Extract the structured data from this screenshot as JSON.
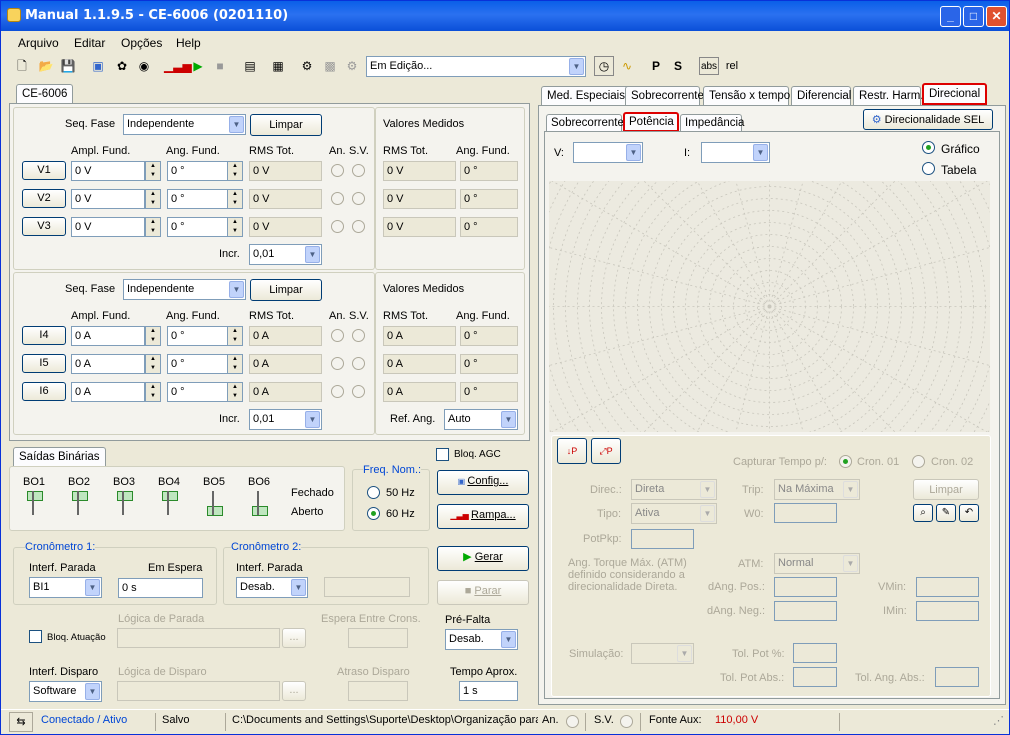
{
  "window": {
    "title": "Manual 1.1.9.5 - CE-6006 (0201110)"
  },
  "menu": [
    "Arquivo",
    "Editar",
    "Opções",
    "Help"
  ],
  "toolbar": {
    "mode": "Em Edição...",
    "abs": "abs",
    "rel": "rel"
  },
  "device_tab": "CE-6006",
  "voltage": {
    "seq_label": "Seq. Fase",
    "seq_value": "Independente",
    "clear": "Limpar",
    "measured_title": "Valores Medidos",
    "headers": {
      "ampl": "Ampl. Fund.",
      "ang": "Ang. Fund.",
      "rms": "RMS Tot.",
      "an": "An.",
      "sv": "S.V.",
      "m_rms": "RMS Tot.",
      "m_ang": "Ang. Fund."
    },
    "rows": [
      {
        "name": "V1",
        "ampl": "0 V",
        "ang": "0 °",
        "rms": "0 V",
        "m_rms": "0 V",
        "m_ang": "0 °"
      },
      {
        "name": "V2",
        "ampl": "0 V",
        "ang": "0 °",
        "rms": "0 V",
        "m_rms": "0 V",
        "m_ang": "0 °"
      },
      {
        "name": "V3",
        "ampl": "0 V",
        "ang": "0 °",
        "rms": "0 V",
        "m_rms": "0 V",
        "m_ang": "0 °"
      }
    ],
    "incr_label": "Incr.",
    "incr": "0,01"
  },
  "current": {
    "seq_label": "Seq. Fase",
    "seq_value": "Independente",
    "clear": "Limpar",
    "measured_title": "Valores Medidos",
    "headers": {
      "ampl": "Ampl. Fund.",
      "ang": "Ang. Fund.",
      "rms": "RMS Tot.",
      "an": "An.",
      "sv": "S.V.",
      "m_rms": "RMS Tot.",
      "m_ang": "Ang. Fund."
    },
    "rows": [
      {
        "name": "I4",
        "ampl": "0 A",
        "ang": "0 °",
        "rms": "0 A",
        "m_rms": "0 A",
        "m_ang": "0 °"
      },
      {
        "name": "I5",
        "ampl": "0 A",
        "ang": "0 °",
        "rms": "0 A",
        "m_rms": "0 A",
        "m_ang": "0 °"
      },
      {
        "name": "I6",
        "ampl": "0 A",
        "ang": "0 °",
        "rms": "0 A",
        "m_rms": "0 A",
        "m_ang": "0 °"
      }
    ],
    "incr_label": "Incr.",
    "incr": "0,01",
    "ref_label": "Ref. Ang.",
    "ref": "Auto"
  },
  "binary": {
    "tab": "Saídas Binárias",
    "outputs": [
      "BO1",
      "BO2",
      "BO3",
      "BO4",
      "BO5",
      "BO6"
    ],
    "closed": "Fechado",
    "open": "Aberto"
  },
  "bloq_agc": "Bloq. AGC",
  "freq": {
    "title": "Freq. Nom.:",
    "opt1": "50 Hz",
    "opt2": "60 Hz"
  },
  "config_btn": "Config...",
  "rampa_btn": "Rampa...",
  "gerar_btn": "Gerar",
  "parar_btn": "Parar",
  "chrono1": {
    "title": "Cronômetro 1:",
    "interf": "Interf. Parada",
    "interf_val": "BI1",
    "wait": "Em Espera",
    "wait_val": "0 s",
    "logic": "Lógica de Parada",
    "bloq": "Bloq. Atuação"
  },
  "chrono2": {
    "title": "Cronômetro 2:",
    "interf": "Interf. Parada",
    "interf_val": "Desab.",
    "between": "Espera Entre Crons."
  },
  "prefalta": {
    "label": "Pré-Falta",
    "value": "Desab."
  },
  "disparo": {
    "interf": "Interf. Disparo",
    "interf_val": "Software",
    "logic": "Lógica de Disparo",
    "delay": "Atraso Disparo"
  },
  "tempo": {
    "label": "Tempo Aprox.",
    "value": "1 s"
  },
  "right_tabs": [
    "Med. Especiais",
    "Sobrecorrente",
    "Tensão x tempo",
    "Diferencial",
    "Restr. Harm.",
    "Direcional"
  ],
  "sub_tabs": [
    "Sobrecorrente",
    "Potência",
    "Impedância"
  ],
  "sel_btn": "Direcionalidade SEL",
  "plot": {
    "v": "V:",
    "i": "I:",
    "grafico": "Gráfico",
    "tabela": "Tabela"
  },
  "bottom": {
    "capture": "Capturar Tempo p/:",
    "cron1": "Cron. 01",
    "cron2": "Cron. 02",
    "direc": "Direc.:",
    "direc_val": "Direta",
    "trip": "Trip:",
    "trip_val": "Na Máxima",
    "limpar": "Limpar",
    "tipo": "Tipo:",
    "tipo_val": "Ativa",
    "w0": "W0:",
    "potpkp": "PotPkp:",
    "torque": "Ang. Torque Máx. (ATM) definido considerando a direcionalidade Direta.",
    "atm": "ATM:",
    "atm_val": "Normal",
    "dang_pos": "dAng. Pos.:",
    "dang_neg": "dAng. Neg.:",
    "vmin": "VMin:",
    "imin": "IMin:",
    "sim": "Simulação:",
    "tol_pot": "Tol. Pot %:",
    "tol_pot_abs": "Tol. Pot Abs.:",
    "tol_ang_abs": "Tol. Ang. Abs.:"
  },
  "status": {
    "conn": "Conectado / Ativo",
    "saved": "Salvo",
    "path": "C:\\Documents and Settings\\Suporte\\Desktop\\Organização para",
    "an": "An.",
    "sv": "S.V.",
    "fonte": "Fonte Aux:",
    "fonte_val": "110,00 V"
  }
}
